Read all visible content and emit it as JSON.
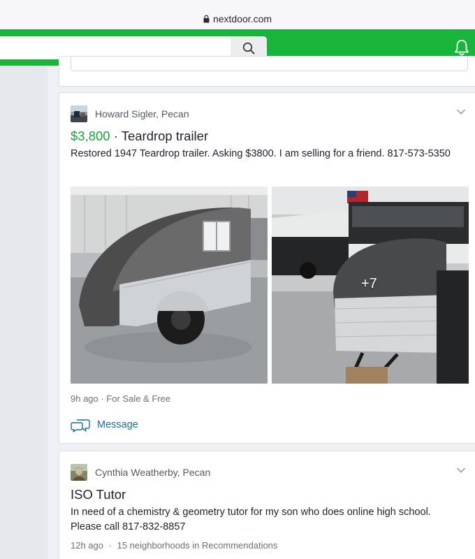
{
  "browser": {
    "url": "nextdoor.com"
  },
  "header": {
    "search_placeholder": ""
  },
  "colors": {
    "brand_green": "#19b43a",
    "price_green": "#1ba33b",
    "link_blue": "#1a6c9b"
  },
  "posts": [
    {
      "author": "Howard Sigler, Pecan",
      "price": "$3,800",
      "separator": " · ",
      "title": "Teardrop trailer",
      "body": "Restored 1947 Teardrop trailer. Asking $3800. I am selling for a friend. 817-573-5350",
      "more_photos": "+7",
      "meta": "9h ago · For Sale & Free",
      "action_label": "Message"
    },
    {
      "author": "Cynthia Weatherby, Pecan",
      "title": "ISO Tutor",
      "body": "In need of a chemistry & geometry tutor for my son who does online high school. Please call 817-832-8857",
      "meta_time": "12h ago",
      "meta_sep": "·",
      "meta_scope": "15 neighborhoods in Recommendations"
    }
  ],
  "icons": [
    "lock-icon",
    "search-icon",
    "bell-icon",
    "chevron-down-icon",
    "chat-bubble-icon"
  ]
}
